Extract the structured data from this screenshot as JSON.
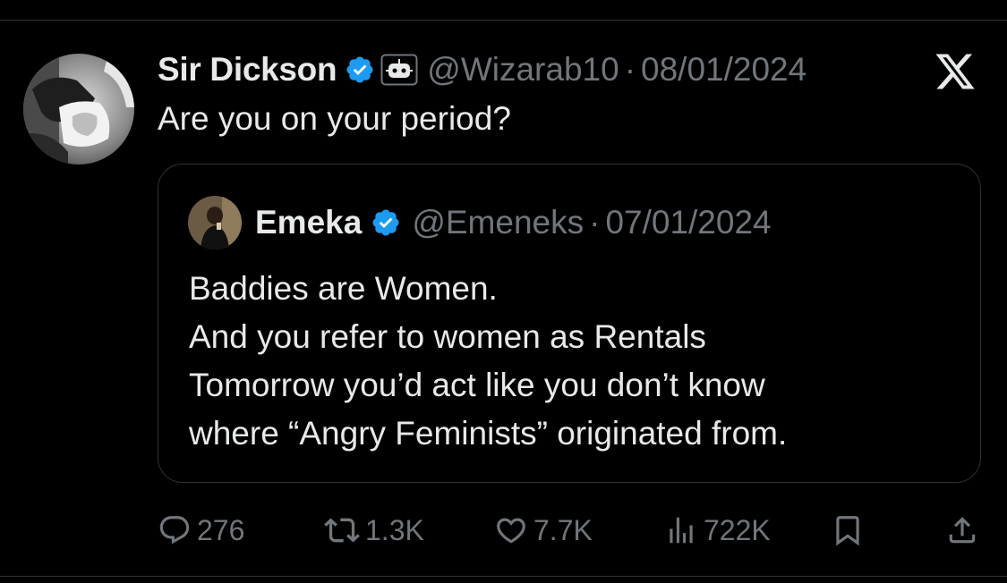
{
  "tweet": {
    "display_name": "Sir Dickson",
    "handle": "@Wizarab10",
    "separator": "·",
    "date": "08/01/2024",
    "text": "Are you on your period?",
    "icons": {
      "verified": "verified-badge-icon",
      "automated": "automated-account-icon",
      "platform": "x-logo-icon"
    }
  },
  "quoted_tweet": {
    "display_name": "Emeka",
    "handle": "@Emeneks",
    "separator": "·",
    "date": "07/01/2024",
    "lines": [
      "Baddies are Women.",
      "And you refer to women as Rentals",
      "Tomorrow you’d act like you don’t know",
      "where “Angry Feminists” originated from."
    ]
  },
  "actions": {
    "replies": "276",
    "reposts": "1.3K",
    "likes": "7.7K",
    "views": "722K",
    "icons": [
      "reply-icon",
      "repost-icon",
      "like-icon",
      "views-icon",
      "bookmark-icon",
      "share-icon"
    ]
  },
  "colors": {
    "background": "#000000",
    "primary_text": "#e7e9ea",
    "secondary_text": "#71767b",
    "verified_blue": "#1d9bf0",
    "border": "#2f3336"
  }
}
